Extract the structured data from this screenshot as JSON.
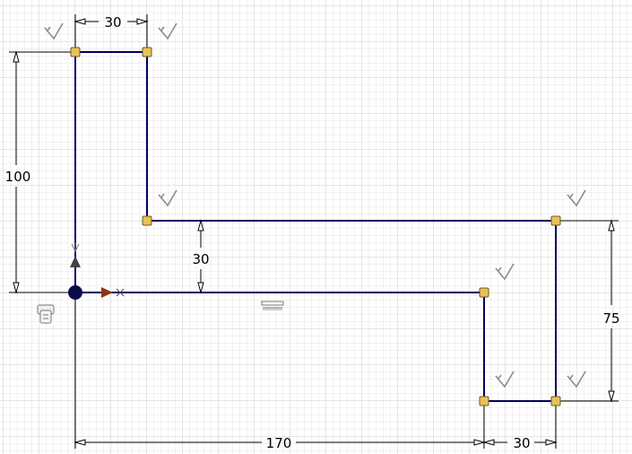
{
  "sketch": {
    "colors": {
      "background": "#ffffff",
      "grid_minor": "#e4e4e4",
      "grid_major": "#cdcdcd",
      "geometry": "#000066",
      "dimension": "#000000",
      "endpoint_fill": "#e8c15a",
      "endpoint_stroke": "#6b5a1e",
      "origin": "#0b0b4a",
      "x_axis": "#8a3a1a",
      "y_axis": "#444444",
      "constraint_glyph": "#8c8c8c"
    },
    "dimensions": {
      "top_width": "30",
      "left_height": "100",
      "inner_gap": "30",
      "right_height": "75",
      "bottom_length": "170",
      "bottom_width": "30"
    },
    "icons": {
      "perpendicular": "perpendicular-constraint-icon",
      "horizontal": "horizontal-constraint-icon",
      "coincident": "coincident-constraint-icon",
      "origin": "sketch-origin-icon",
      "x_axis": "x-axis-arrow-icon",
      "y_axis": "y-axis-arrow-icon"
    }
  }
}
